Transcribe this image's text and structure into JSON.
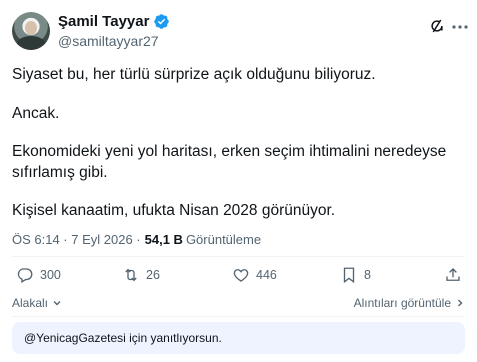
{
  "author": {
    "name": "Şamil Tayyar",
    "handle": "@samiltayyar27",
    "verified": true
  },
  "tweet": {
    "lines": [
      "Siyaset bu, her türlü sürprize açık olduğunu biliyoruz.",
      "Ancak.",
      "Ekonomideki yeni yol haritası, erken seçim ihtimalini neredeyse sıfırlamış gibi.",
      "Kişisel kanaatim, ufukta Nisan 2028 görünüyor."
    ]
  },
  "meta": {
    "timestamp": "ÖS 6:14 · 7 Eyl 2026 · ",
    "views": "54,1 B",
    "views_label": "Görüntüleme"
  },
  "actions": {
    "replies": "300",
    "reposts": "26",
    "likes": "446",
    "bookmarks": "8"
  },
  "links": {
    "sort": "Alakalı",
    "quotes": "Alıntıları görüntüle"
  },
  "reply_notice": "@YenicagGazetesi için yanıtlıyorsun.",
  "colors": {
    "verified": "#1d9bf0",
    "muted": "#536471",
    "banner": "#eef3ff"
  },
  "icons": [
    "grok-icon",
    "more-icon",
    "reply-icon",
    "repost-icon",
    "like-icon",
    "bookmark-icon",
    "share-icon",
    "chevron-down-icon",
    "chevron-right-icon",
    "verified-badge-icon"
  ]
}
